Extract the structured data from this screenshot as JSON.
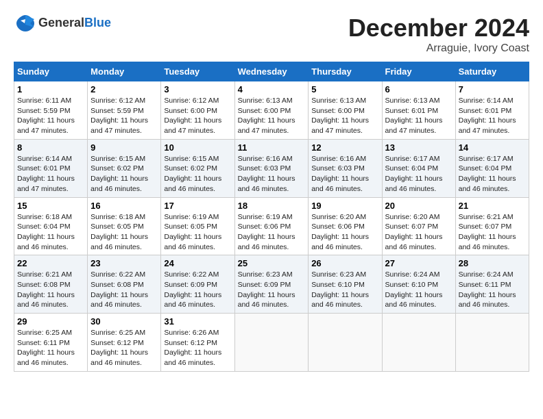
{
  "header": {
    "logo_line1": "General",
    "logo_line2": "Blue",
    "month": "December 2024",
    "location": "Arraguie, Ivory Coast"
  },
  "days_of_week": [
    "Sunday",
    "Monday",
    "Tuesday",
    "Wednesday",
    "Thursday",
    "Friday",
    "Saturday"
  ],
  "weeks": [
    [
      {
        "day": "1",
        "info": "Sunrise: 6:11 AM\nSunset: 5:59 PM\nDaylight: 11 hours\nand 47 minutes."
      },
      {
        "day": "2",
        "info": "Sunrise: 6:12 AM\nSunset: 5:59 PM\nDaylight: 11 hours\nand 47 minutes."
      },
      {
        "day": "3",
        "info": "Sunrise: 6:12 AM\nSunset: 6:00 PM\nDaylight: 11 hours\nand 47 minutes."
      },
      {
        "day": "4",
        "info": "Sunrise: 6:13 AM\nSunset: 6:00 PM\nDaylight: 11 hours\nand 47 minutes."
      },
      {
        "day": "5",
        "info": "Sunrise: 6:13 AM\nSunset: 6:00 PM\nDaylight: 11 hours\nand 47 minutes."
      },
      {
        "day": "6",
        "info": "Sunrise: 6:13 AM\nSunset: 6:01 PM\nDaylight: 11 hours\nand 47 minutes."
      },
      {
        "day": "7",
        "info": "Sunrise: 6:14 AM\nSunset: 6:01 PM\nDaylight: 11 hours\nand 47 minutes."
      }
    ],
    [
      {
        "day": "8",
        "info": "Sunrise: 6:14 AM\nSunset: 6:01 PM\nDaylight: 11 hours\nand 47 minutes."
      },
      {
        "day": "9",
        "info": "Sunrise: 6:15 AM\nSunset: 6:02 PM\nDaylight: 11 hours\nand 46 minutes."
      },
      {
        "day": "10",
        "info": "Sunrise: 6:15 AM\nSunset: 6:02 PM\nDaylight: 11 hours\nand 46 minutes."
      },
      {
        "day": "11",
        "info": "Sunrise: 6:16 AM\nSunset: 6:03 PM\nDaylight: 11 hours\nand 46 minutes."
      },
      {
        "day": "12",
        "info": "Sunrise: 6:16 AM\nSunset: 6:03 PM\nDaylight: 11 hours\nand 46 minutes."
      },
      {
        "day": "13",
        "info": "Sunrise: 6:17 AM\nSunset: 6:04 PM\nDaylight: 11 hours\nand 46 minutes."
      },
      {
        "day": "14",
        "info": "Sunrise: 6:17 AM\nSunset: 6:04 PM\nDaylight: 11 hours\nand 46 minutes."
      }
    ],
    [
      {
        "day": "15",
        "info": "Sunrise: 6:18 AM\nSunset: 6:04 PM\nDaylight: 11 hours\nand 46 minutes."
      },
      {
        "day": "16",
        "info": "Sunrise: 6:18 AM\nSunset: 6:05 PM\nDaylight: 11 hours\nand 46 minutes."
      },
      {
        "day": "17",
        "info": "Sunrise: 6:19 AM\nSunset: 6:05 PM\nDaylight: 11 hours\nand 46 minutes."
      },
      {
        "day": "18",
        "info": "Sunrise: 6:19 AM\nSunset: 6:06 PM\nDaylight: 11 hours\nand 46 minutes."
      },
      {
        "day": "19",
        "info": "Sunrise: 6:20 AM\nSunset: 6:06 PM\nDaylight: 11 hours\nand 46 minutes."
      },
      {
        "day": "20",
        "info": "Sunrise: 6:20 AM\nSunset: 6:07 PM\nDaylight: 11 hours\nand 46 minutes."
      },
      {
        "day": "21",
        "info": "Sunrise: 6:21 AM\nSunset: 6:07 PM\nDaylight: 11 hours\nand 46 minutes."
      }
    ],
    [
      {
        "day": "22",
        "info": "Sunrise: 6:21 AM\nSunset: 6:08 PM\nDaylight: 11 hours\nand 46 minutes."
      },
      {
        "day": "23",
        "info": "Sunrise: 6:22 AM\nSunset: 6:08 PM\nDaylight: 11 hours\nand 46 minutes."
      },
      {
        "day": "24",
        "info": "Sunrise: 6:22 AM\nSunset: 6:09 PM\nDaylight: 11 hours\nand 46 minutes."
      },
      {
        "day": "25",
        "info": "Sunrise: 6:23 AM\nSunset: 6:09 PM\nDaylight: 11 hours\nand 46 minutes."
      },
      {
        "day": "26",
        "info": "Sunrise: 6:23 AM\nSunset: 6:10 PM\nDaylight: 11 hours\nand 46 minutes."
      },
      {
        "day": "27",
        "info": "Sunrise: 6:24 AM\nSunset: 6:10 PM\nDaylight: 11 hours\nand 46 minutes."
      },
      {
        "day": "28",
        "info": "Sunrise: 6:24 AM\nSunset: 6:11 PM\nDaylight: 11 hours\nand 46 minutes."
      }
    ],
    [
      {
        "day": "29",
        "info": "Sunrise: 6:25 AM\nSunset: 6:11 PM\nDaylight: 11 hours\nand 46 minutes."
      },
      {
        "day": "30",
        "info": "Sunrise: 6:25 AM\nSunset: 6:12 PM\nDaylight: 11 hours\nand 46 minutes."
      },
      {
        "day": "31",
        "info": "Sunrise: 6:26 AM\nSunset: 6:12 PM\nDaylight: 11 hours\nand 46 minutes."
      },
      {
        "day": "",
        "info": ""
      },
      {
        "day": "",
        "info": ""
      },
      {
        "day": "",
        "info": ""
      },
      {
        "day": "",
        "info": ""
      }
    ]
  ]
}
